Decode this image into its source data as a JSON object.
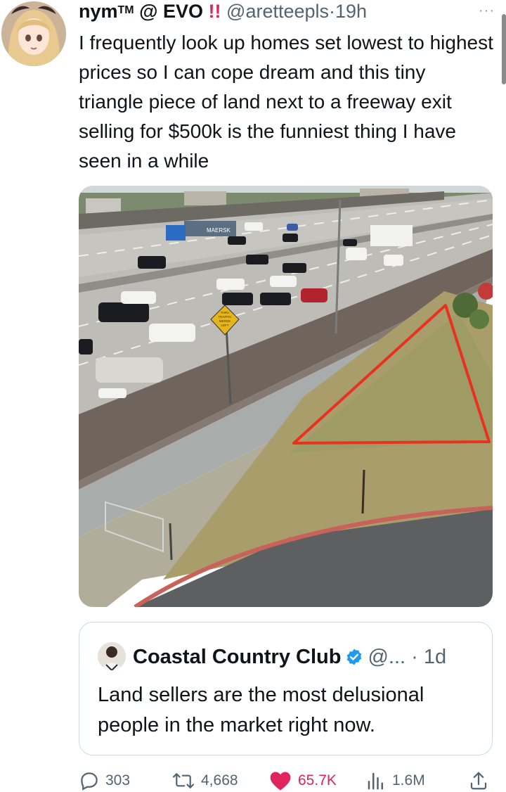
{
  "tweet": {
    "display_name": "nym",
    "tm": "TM",
    "name_suffix": "@ EVO",
    "emoji": "!!",
    "handle": "@aretteepls",
    "separator": "·",
    "time": "19h",
    "more": "···",
    "text": "I frequently look up homes set lowest to highest prices so I can cope dream and this tiny triangle piece of land next to a freeway exit selling for $500k is the funniest thing I have seen in a while"
  },
  "media": {
    "truck_label": "MAERSK",
    "sign_text": [
      "THRU",
      "TRAFFIC",
      "MERGE",
      "LEFT"
    ],
    "highlight_color": "#e8321f"
  },
  "quote": {
    "display_name": "Coastal Country Club",
    "handle": "@...",
    "separator": "·",
    "time": "1d",
    "text": "Land sellers are the most delusional people in the market right now."
  },
  "actions": {
    "replies": "303",
    "reposts": "4,668",
    "likes": "65.7K",
    "views": "1.6M"
  },
  "colors": {
    "like": "#e0245e",
    "verified": "#1d9bf0",
    "muted": "#536471"
  }
}
